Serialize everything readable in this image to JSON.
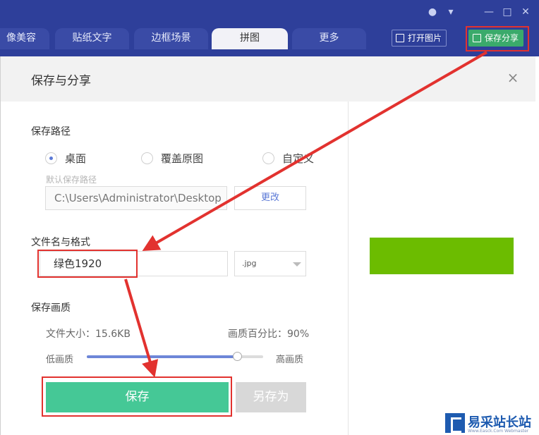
{
  "toolbar": {
    "tabs": [
      "像美容",
      "贴纸文字",
      "边框场景",
      "拼图",
      "更多"
    ],
    "active_tab": "拼图",
    "open_image_label": "打开图片",
    "save_share_label": "保存分享"
  },
  "dialog": {
    "title": "保存与分享",
    "save_path": {
      "section_title": "保存路径",
      "options": [
        "桌面",
        "覆盖原图",
        "自定义"
      ],
      "selected": "桌面",
      "default_hint": "默认保存路径",
      "path_value": "C:\\Users\\Administrator\\Desktop",
      "change_label": "更改"
    },
    "file": {
      "section_title": "文件名与格式",
      "name_value": "绿色1920",
      "format_value": ".jpg"
    },
    "quality": {
      "section_title": "保存画质",
      "file_size_text": "文件大小：15.6KB",
      "percent_text": "画质百分比：90%",
      "percent_value": 90,
      "low_label": "低画质",
      "high_label": "高画质"
    },
    "save_label": "保存",
    "save_as_label": "另存为"
  },
  "preview": {
    "color": "#6cbc00"
  },
  "watermark": {
    "title": "易采站长站",
    "subtitle": "Www.Easck.Com Webmaster"
  }
}
